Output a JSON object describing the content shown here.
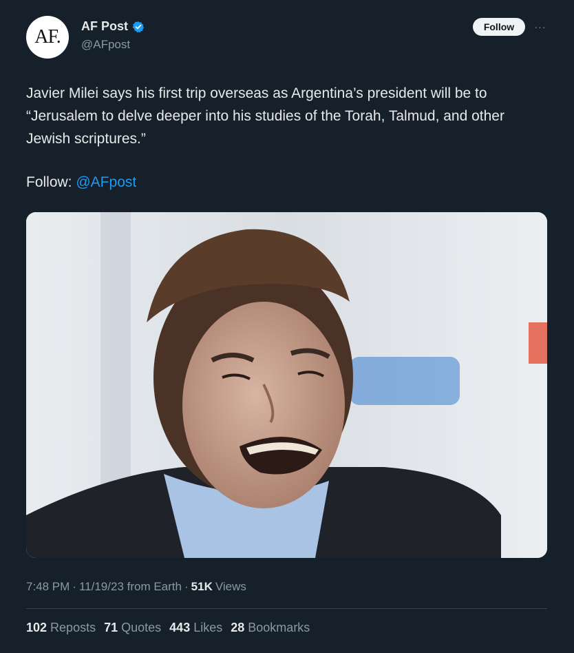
{
  "author": {
    "avatar_text": "AF.",
    "display_name": "AF Post",
    "handle": "@AFpost",
    "verified_color": "#1d9bf0"
  },
  "header": {
    "follow_label": "Follow",
    "more_label": "···"
  },
  "tweet": {
    "text": "Javier Milei says his first trip overseas as Argentina’s president will be to “Jerusalem to delve deeper into his studies of the Torah, Talmud, and other Jewish scriptures.”",
    "follow_prefix": "Follow: ",
    "follow_mention": "@AFpost"
  },
  "meta": {
    "time": "7:48 PM",
    "sep1": "·",
    "date_source": "11/19/23 from Earth",
    "sep2": "·",
    "views_count": "51K",
    "views_label": "Views"
  },
  "stats": [
    {
      "count": "102",
      "label": "Reposts"
    },
    {
      "count": "71",
      "label": "Quotes"
    },
    {
      "count": "443",
      "label": "Likes"
    },
    {
      "count": "28",
      "label": "Bookmarks"
    }
  ],
  "colors": {
    "background": "#15202b",
    "text": "#e7e9ea",
    "muted": "#8b98a5",
    "accent": "#1d9bf0"
  }
}
